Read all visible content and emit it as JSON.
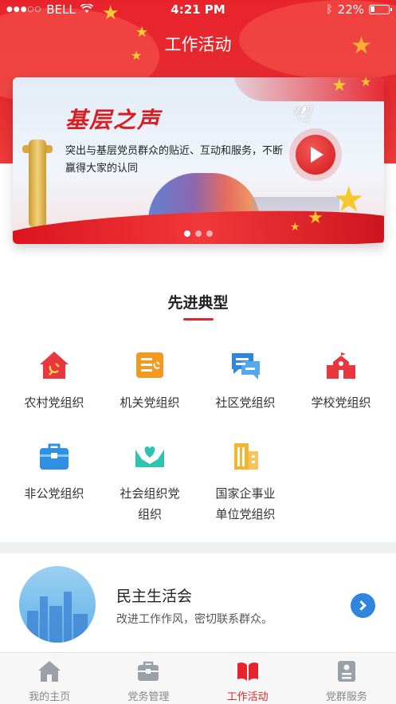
{
  "status_bar": {
    "carrier": "BELL",
    "time": "4:21 PM",
    "battery": "22%"
  },
  "header": {
    "title": "工作活动"
  },
  "banner": {
    "title": "基层之声",
    "description": "突出与基层党员群众的贴近、互动和服务，不断赢得大家的认同",
    "pages": 3,
    "active_page": 1
  },
  "section": {
    "title": "先进典型"
  },
  "categories": [
    {
      "label": "农村党组织",
      "icon": "party-house-icon",
      "color": "#e8383d"
    },
    {
      "label": "机关党组织",
      "icon": "party-document-icon",
      "color": "#f39a1e"
    },
    {
      "label": "社区党组织",
      "icon": "chat-bubbles-icon",
      "color": "#2f86e0"
    },
    {
      "label": "学校党组织",
      "icon": "school-building-icon",
      "color": "#e8383d"
    },
    {
      "label": "非公党组织",
      "icon": "briefcase-icon",
      "color": "#2f8fe0"
    },
    {
      "label": "社会组织党组织",
      "icon": "hands-heart-icon",
      "color": "#2fc4b0"
    },
    {
      "label": "国家企事业单位党组织",
      "icon": "office-buildings-icon",
      "color": "#f5b530"
    }
  ],
  "category_lines": [
    [
      "农村党组织"
    ],
    [
      "机关党组织"
    ],
    [
      "社区党组织"
    ],
    [
      "学校党组织"
    ],
    [
      "非公党组织"
    ],
    [
      "社会组织党",
      "组织"
    ],
    [
      "国家企事业",
      "单位党组织"
    ]
  ],
  "life_card": {
    "title": "民主生活会",
    "subtitle": "改进工作作风，密切联系群众。"
  },
  "tabs": [
    {
      "label": "我的主页",
      "icon": "home-icon",
      "active": false
    },
    {
      "label": "党务管理",
      "icon": "toolbox-icon",
      "active": false
    },
    {
      "label": "工作活动",
      "icon": "book-icon",
      "active": true
    },
    {
      "label": "党群服务",
      "icon": "id-card-icon",
      "active": false
    }
  ],
  "colors": {
    "brand_red": "#e8232c",
    "link_blue": "#2e86de"
  }
}
